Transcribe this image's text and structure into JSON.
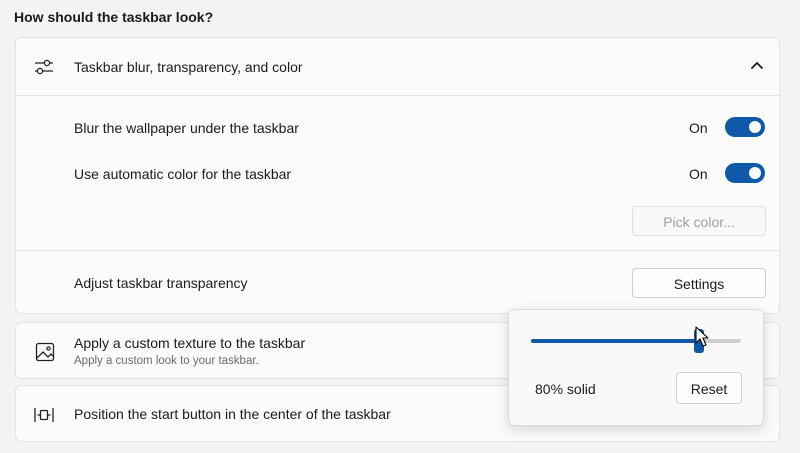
{
  "section": {
    "title": "How should the taskbar look?"
  },
  "blur_card": {
    "header": {
      "label": "Taskbar blur, transparency, and color",
      "icon": "sliders-icon",
      "expand_icon": "chevron-up-icon"
    },
    "blur_wallpaper": {
      "label": "Blur the wallpaper under the taskbar",
      "state": "On"
    },
    "auto_color": {
      "label": "Use automatic color for the taskbar",
      "state": "On"
    },
    "pick_color": {
      "label": "Pick color..."
    },
    "transparency": {
      "label": "Adjust taskbar transparency",
      "button": "Settings"
    }
  },
  "texture_card": {
    "icon": "image-icon",
    "label": "Apply a custom texture to the taskbar",
    "sublabel": "Apply a custom look to your taskbar."
  },
  "position_card": {
    "icon": "center-align-icon",
    "label": "Position the start button in the center of the taskbar"
  },
  "transparency_flyout": {
    "slider_value_percent": 80,
    "value_label": "80% solid",
    "reset_label": "Reset"
  },
  "colors": {
    "accent": "#0e5aa8"
  }
}
